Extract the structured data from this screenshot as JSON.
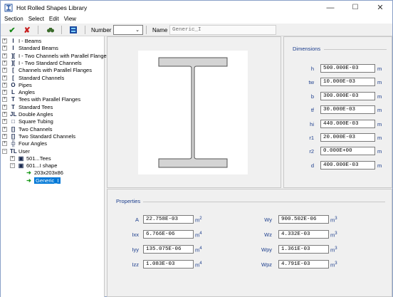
{
  "window": {
    "title": "Hot Rolled Shapes Library",
    "minimize": "—",
    "maximize": "☐",
    "close": "✕"
  },
  "menu": [
    "Section",
    "Select",
    "Edit",
    "View"
  ],
  "toolbar": {
    "ok_icon": "check-icon",
    "cancel_icon": "x-icon",
    "find_icon": "binoculars-icon",
    "library_icon": "book-icon",
    "number_label": "Number",
    "number_value": "",
    "name_label": "Name",
    "name_value": "Generic_I"
  },
  "tree": [
    {
      "label": "I - Beams",
      "sym": "I",
      "expander": "+"
    },
    {
      "label": "Standard Beams",
      "sym": "I",
      "expander": "+"
    },
    {
      "label": "I - Two Channels with Parallel Flanges",
      "sym": "][",
      "expander": "+"
    },
    {
      "label": "I - Two Standard Channels",
      "sym": "][",
      "expander": "+"
    },
    {
      "label": "Channels with Parallel Flanges",
      "sym": "[",
      "expander": "+"
    },
    {
      "label": "Standard Channels",
      "sym": "[",
      "expander": "+"
    },
    {
      "label": "Pipes",
      "sym": "O",
      "expander": "+"
    },
    {
      "label": "Angles",
      "sym": "L",
      "expander": "+"
    },
    {
      "label": "Tees with Parallel Flanges",
      "sym": "T",
      "expander": "+"
    },
    {
      "label": "Standard Tees",
      "sym": "T",
      "expander": "+"
    },
    {
      "label": "Double Angles",
      "sym": "JL",
      "expander": "+"
    },
    {
      "label": "Square Tubing",
      "sym": "□",
      "expander": "+"
    },
    {
      "label": "Two Channels",
      "sym": "[]",
      "expander": "+"
    },
    {
      "label": "Two Standard Channels",
      "sym": "[]",
      "expander": "+"
    },
    {
      "label": "Four Angles",
      "sym": "╬",
      "expander": "+"
    },
    {
      "label": "User",
      "sym": "TL",
      "expander": "−"
    },
    {
      "label": "501...Tees",
      "sym": "▣",
      "expander": "+"
    },
    {
      "label": "601...I shape",
      "sym": "▣",
      "expander": "−"
    },
    {
      "label": "203x203x86",
      "sym": "➜",
      "expander": ""
    },
    {
      "label": "Generic_I",
      "sym": "➜",
      "expander": "",
      "selected": true
    }
  ],
  "dimensions": {
    "title": "Dimensions",
    "rows": [
      {
        "label": "h",
        "value": "500.000E-03",
        "unit": "m"
      },
      {
        "label": "tw",
        "value": "10.000E-03",
        "unit": "m"
      },
      {
        "label": "b",
        "value": "300.000E-03",
        "unit": "m"
      },
      {
        "label": "tf",
        "value": "30.000E-03",
        "unit": "m"
      },
      {
        "label": "hi",
        "value": "440.000E-03",
        "unit": "m"
      },
      {
        "label": "r1",
        "value": "20.000E-03",
        "unit": "m"
      },
      {
        "label": "r2",
        "value": "0.000E+00",
        "unit": "m"
      },
      {
        "label": "d",
        "value": "400.000E-03",
        "unit": "m"
      }
    ]
  },
  "properties": {
    "title": "Properties",
    "left": [
      {
        "label": "A",
        "value": "22.758E-03",
        "unit": "m",
        "exp": "2"
      },
      {
        "label": "Ixx",
        "value": "6.766E-06",
        "unit": "m",
        "exp": "4"
      },
      {
        "label": "Iyy",
        "value": "135.075E-06",
        "unit": "m",
        "exp": "4"
      },
      {
        "label": "Izz",
        "value": "1.083E-03",
        "unit": "m",
        "exp": "4"
      }
    ],
    "right": [
      {
        "label": "Wy",
        "value": "900.502E-06",
        "unit": "m",
        "exp": "3"
      },
      {
        "label": "Wz",
        "value": "4.332E-03",
        "unit": "m",
        "exp": "3"
      },
      {
        "label": "Wpy",
        "value": "1.361E-03",
        "unit": "m",
        "exp": "3"
      },
      {
        "label": "Wpz",
        "value": "4.791E-03",
        "unit": "m",
        "exp": "3"
      }
    ]
  },
  "colors": {
    "accent": "#0078d7",
    "label_blue": "#1a3c8c",
    "ok_green": "#1a8a1a",
    "cancel_red": "#c81e1e"
  }
}
